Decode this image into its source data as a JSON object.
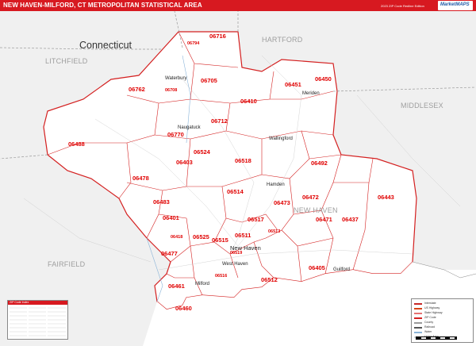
{
  "header": {
    "title": "NEW HAVEN-MILFORD, CT METROPOLITAN STATISTICAL AREA",
    "edition": "2023 ZIP Code Redline Edition",
    "logo_text": "MarketMAPS"
  },
  "map": {
    "state_label": "Connecticut",
    "regions": [
      {
        "name": "LITCHFIELD"
      },
      {
        "name": "HARTFORD"
      },
      {
        "name": "MIDDLESEX"
      },
      {
        "name": "FAIRFIELD"
      },
      {
        "name": "NEW HAVEN"
      }
    ],
    "zip_codes": [
      "06716",
      "06794",
      "06762",
      "06708",
      "06705",
      "06451",
      "06450",
      "06410",
      "06712",
      "06488",
      "06770",
      "06524",
      "06518",
      "06403",
      "06492",
      "06478",
      "06514",
      "06472",
      "06443",
      "06483",
      "06473",
      "06401",
      "06471",
      "06437",
      "06517",
      "06418",
      "06525",
      "06515",
      "06511",
      "06513",
      "06477",
      "06516",
      "06405",
      "06461",
      "06512",
      "06460",
      "06519"
    ],
    "cities": [
      "Waterbury",
      "Meriden",
      "Naugatuck",
      "Hamden",
      "New Haven",
      "Milford",
      "Guilford",
      "West Haven",
      "Wallingford"
    ],
    "colors": {
      "zip_label": "#e00000",
      "zip_boundary": "#d42020",
      "county_boundary": "#9a9a9a",
      "water": "#ffffff",
      "outside_area": "#f0f0f0",
      "title_bar": "#d71920"
    }
  },
  "index_box": {
    "title": "ZIP Code Index"
  },
  "legend": {
    "rows": [
      {
        "label": "Interstate",
        "color": "#c62828"
      },
      {
        "label": "US Highway",
        "color": "#d84315"
      },
      {
        "label": "State Highway",
        "color": "#e57373"
      },
      {
        "label": "ZIP Code",
        "color": "#d42020"
      },
      {
        "label": "County",
        "color": "#9a9a9a"
      },
      {
        "label": "Railroad",
        "color": "#555555"
      },
      {
        "label": "Water",
        "color": "#8ab4d8"
      },
      {
        "label": "Urban Area",
        "color": "#cfd8dc"
      }
    ]
  }
}
